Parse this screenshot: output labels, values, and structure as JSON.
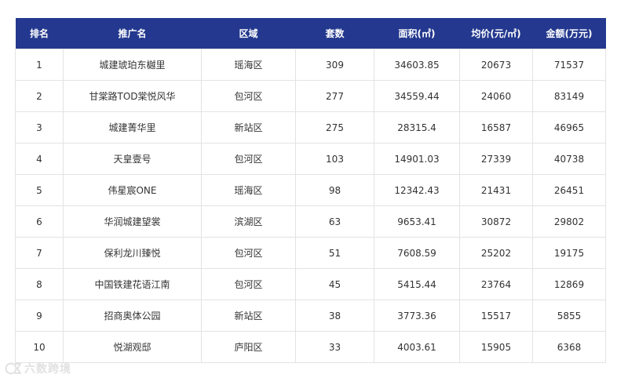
{
  "table": {
    "headers": [
      "排名",
      "推广名",
      "区域",
      "套数",
      "面积(㎡)",
      "均价(元/㎡)",
      "金额(万元)"
    ],
    "rows": [
      [
        "1",
        "城建琥珀东樾里",
        "瑶海区",
        "309",
        "34603.85",
        "20673",
        "71537"
      ],
      [
        "2",
        "甘棠路TOD棠悦风华",
        "包河区",
        "277",
        "34559.44",
        "24060",
        "83149"
      ],
      [
        "3",
        "城建菁华里",
        "新站区",
        "275",
        "28315.4",
        "16587",
        "46965"
      ],
      [
        "4",
        "天皇壹号",
        "包河区",
        "103",
        "14901.03",
        "27339",
        "40738"
      ],
      [
        "5",
        "伟星宸ONE",
        "瑶海区",
        "98",
        "12342.43",
        "21431",
        "26451"
      ],
      [
        "6",
        "华润城建望裳",
        "滨湖区",
        "63",
        "9653.41",
        "30872",
        "29802"
      ],
      [
        "7",
        "保利龙川臻悦",
        "包河区",
        "51",
        "7608.59",
        "25202",
        "19175"
      ],
      [
        "8",
        "中国铁建花语江南",
        "包河区",
        "45",
        "5415.44",
        "23764",
        "12869"
      ],
      [
        "9",
        "招商奥体公园",
        "新站区",
        "38",
        "3773.36",
        "15517",
        "5855"
      ],
      [
        "10",
        "悦湖观邸",
        "庐阳区",
        "33",
        "4003.61",
        "15905",
        "6368"
      ]
    ]
  },
  "watermark": {
    "text": "六数跨境",
    "icon": "logo-mark-icon"
  },
  "colors": {
    "header_bg": "#23388e",
    "header_text": "#ffffff",
    "cell_text": "#333333",
    "border": "#e3e3e3"
  }
}
